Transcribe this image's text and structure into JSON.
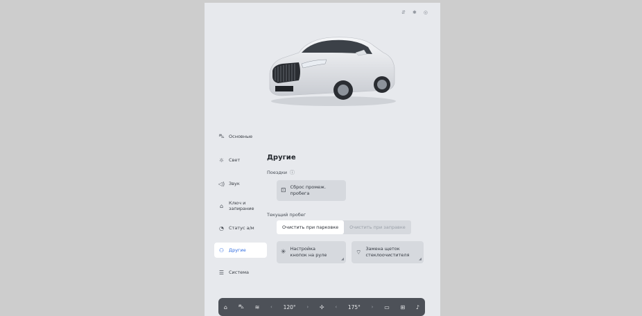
{
  "status_icons": [
    "sync-icon",
    "bluetooth-icon",
    "location-icon"
  ],
  "sidebar": {
    "items": [
      {
        "label": "Основные",
        "icon": "car-icon"
      },
      {
        "label": "Свет",
        "icon": "sun-icon"
      },
      {
        "label": "Звук",
        "icon": "speaker-icon"
      },
      {
        "label": "Ключ и запирание",
        "icon": "lock-car-icon"
      },
      {
        "label": "Статус а/м",
        "icon": "gauge-icon"
      },
      {
        "label": "Другие",
        "icon": "car-wrench-icon"
      },
      {
        "label": "Система",
        "icon": "sliders-icon"
      }
    ],
    "active_index": 5
  },
  "content": {
    "title": "Другие",
    "trips_label": "Поездки",
    "reset_trip_label": "Сброс промеж. пробега",
    "current_mileage_label": "Текущий пробег",
    "segmented": {
      "option_a": "Очистить при парковке",
      "option_b": "Очистить при заправке",
      "selected": "option_a"
    },
    "steering_buttons_label": "Настройка кнопок на руле",
    "wiper_replace_label": "Замена щеток стеклоочистителя"
  },
  "dock": {
    "left_temp": "120°",
    "right_temp": "175°"
  },
  "colors": {
    "accent": "#2f6be0",
    "screen_bg": "#e7e9ed",
    "card_bg": "#d6d9de",
    "dock_bg": "#4d5158"
  }
}
